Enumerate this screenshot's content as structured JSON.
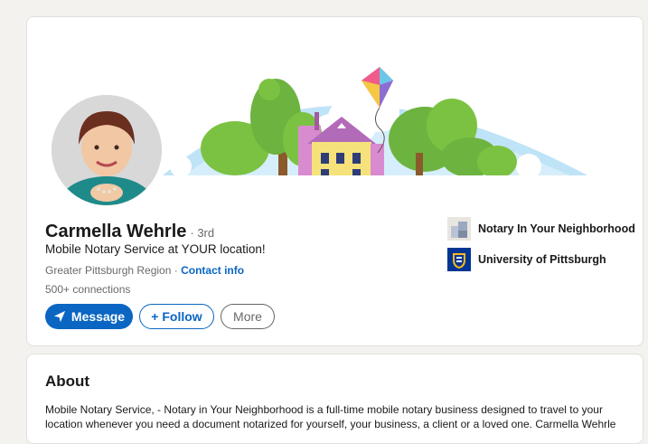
{
  "profile": {
    "name": "Carmella Wehrle",
    "degree": "· 3rd",
    "headline": "Mobile Notary Service at YOUR location!",
    "location": "Greater Pittsburgh Region ·",
    "contact_info": "Contact info",
    "connections": "500+ connections"
  },
  "actions": {
    "message_label": "Message",
    "follow_label": "+ Follow",
    "more_label": "More"
  },
  "organizations": [
    {
      "name": "Notary In Your Neighborhood",
      "icon": "company-logo-icon"
    },
    {
      "name": "University of Pittsburgh",
      "icon": "university-crest-icon"
    }
  ],
  "about": {
    "title": "About",
    "text": "Mobile Notary Service, - Notary in Your Neighborhood is a full-time mobile notary business designed to travel to your location whenever you need a document notarized for yourself, your business, a client or a loved one. Carmella Wehrle"
  },
  "colors": {
    "accent": "#0a66c2",
    "page_background": "#f3f2ef"
  }
}
